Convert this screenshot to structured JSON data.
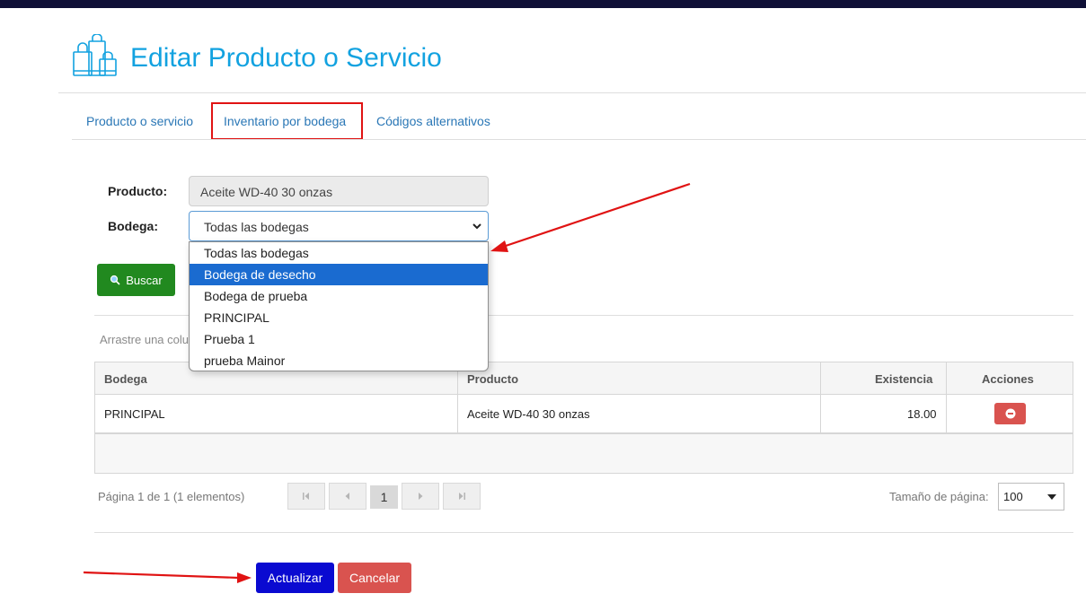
{
  "header": {
    "title": "Editar Producto o Servicio",
    "icon": "shopping-bags-icon"
  },
  "tabs": [
    {
      "label": "Producto o servicio",
      "active": false
    },
    {
      "label": "Inventario por bodega",
      "active": true
    },
    {
      "label": "Códigos alternativos",
      "active": false
    }
  ],
  "form": {
    "producto_label": "Producto:",
    "producto_value": "Aceite WD-40 30 onzas",
    "bodega_label": "Bodega:",
    "bodega_value": "Todas las bodegas",
    "bodega_options": [
      "Todas las bodegas",
      "Bodega de desecho",
      "Bodega de prueba",
      "PRINCIPAL",
      "Prueba 1",
      "prueba Mainor"
    ],
    "bodega_highlighted": "Bodega de desecho",
    "buscar_label": "Buscar"
  },
  "grid": {
    "drag_hint": "Arrastre una colu",
    "columns": [
      "Bodega",
      "Producto",
      "Existencia",
      "Acciones"
    ],
    "rows": [
      {
        "bodega": "PRINCIPAL",
        "producto": "Aceite WD-40 30 onzas",
        "existencia": "18.00"
      }
    ]
  },
  "pager": {
    "info": "Página 1 de 1 (1 elementos)",
    "current_page": "1",
    "page_size_label": "Tamaño de página:",
    "page_size": "100"
  },
  "actions": {
    "update_label": "Actualizar",
    "cancel_label": "Cancelar"
  },
  "colors": {
    "title": "#12a2e0",
    "tab_link": "#2a77b6",
    "annotation_red": "#e01313",
    "buscar_green": "#21891f",
    "update_blue": "#0a0ad1",
    "danger": "#d9534f",
    "dropdown_highlight": "#1a6bd0"
  }
}
